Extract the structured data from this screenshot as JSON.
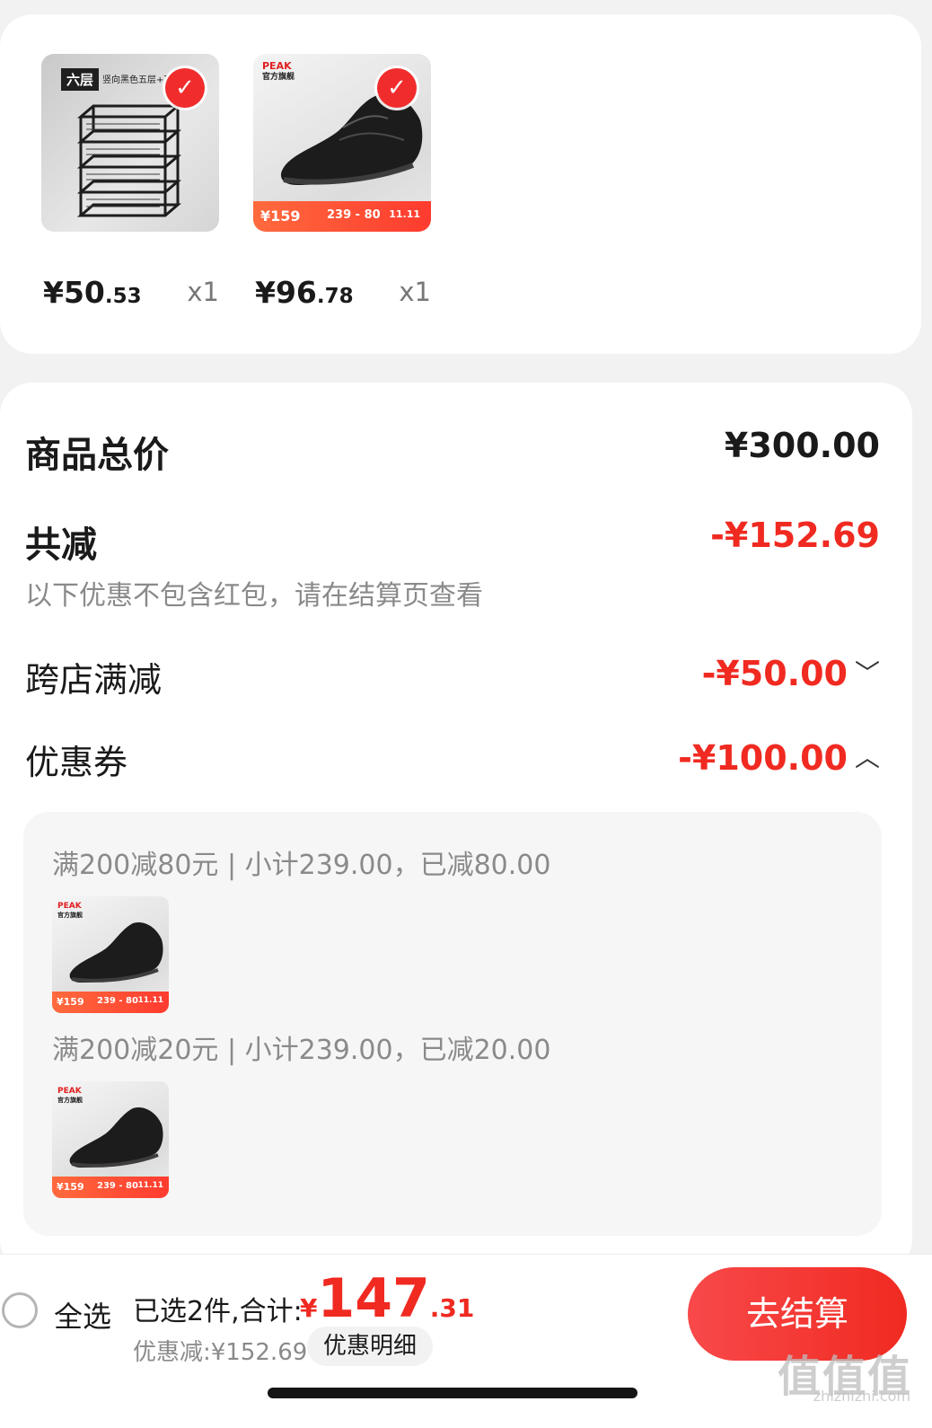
{
  "products": [
    {
      "name": "shelf",
      "tag": "六层",
      "tag_sub": "竖向黑色五层+顶",
      "price_int": "¥50",
      "price_dec": ".53",
      "qty": "x1"
    },
    {
      "name": "shoe",
      "brand": "PEAK",
      "brand_sub": "官方旗舰",
      "promo_a": "¥159",
      "promo_b": "239 - 80",
      "promo_c": "11.11",
      "price_int": "¥96",
      "price_dec": ".78",
      "qty": "x1"
    }
  ],
  "summary": {
    "total_label": "商品总价",
    "total_value": "¥300.00",
    "reduce_label": "共减",
    "reduce_value": "-¥152.69",
    "reduce_note": "以下优惠不包含红包，请在结算页查看",
    "cross_store_label": "跨店满减",
    "cross_store_value": "-¥50.00",
    "cross_store_chevron": "﹀",
    "coupon_label": "优惠券",
    "coupon_value": "-¥100.00",
    "coupon_chevron": "︿"
  },
  "coupon_details": [
    {
      "text": "满200减80元 | 小计239.00，已减80.00"
    },
    {
      "text": "满200减20元 | 小计239.00，已减20.00"
    }
  ],
  "bottom": {
    "select_all": "全选",
    "selected_count": "已选2件,合计:",
    "total_currency": "¥",
    "total_int": "147",
    "total_dec": ".31",
    "discount": "优惠减:¥152.69",
    "detail_button": "优惠明细",
    "checkout_button": "去结算",
    "watermark": "值值值",
    "watermark_sub": "zhizhizhi.com"
  },
  "colors": {
    "accent": "#f02a21",
    "muted": "#8a8a8a"
  },
  "icons": {
    "check": "check-icon",
    "chevron_down": "chevron-down-icon",
    "chevron_up": "chevron-up-icon",
    "radio": "radio-unchecked-icon"
  }
}
